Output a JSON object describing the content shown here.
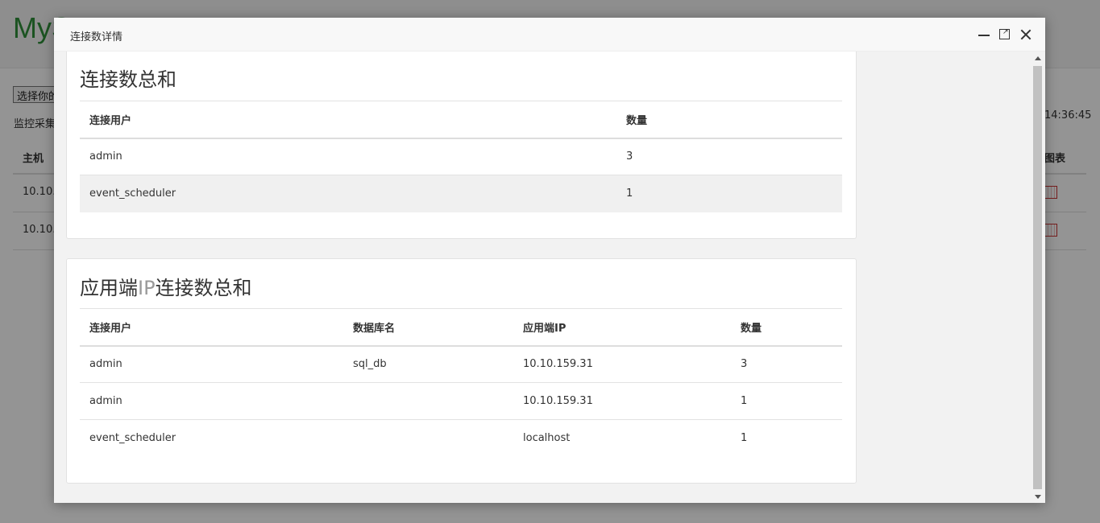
{
  "background": {
    "title": "MyS",
    "select_label": "选择你的",
    "collect_label": "监控采集",
    "time_label": "14:36:45",
    "table_headers": [
      "主机",
      "图表"
    ],
    "table_rows": [
      {
        "host": "10.10.1"
      },
      {
        "host": "10.10.1"
      }
    ]
  },
  "dialog": {
    "title": "连接数详情",
    "controls": {
      "minimize": "minimize-icon",
      "maximize": "maximize-icon",
      "close": "close-icon"
    }
  },
  "panel1": {
    "title": "连接数总和",
    "headers": [
      "连接用户",
      "数量"
    ],
    "rows": [
      [
        "admin",
        "3"
      ],
      [
        "event_scheduler",
        "1"
      ]
    ]
  },
  "panel2": {
    "title_prefix": "应用端",
    "title_ip": "IP",
    "title_suffix": "连接数总和",
    "headers": [
      "连接用户",
      "数据库名",
      "应用端IP",
      "数量"
    ],
    "rows": [
      [
        "admin",
        "sql_db",
        "10.10.159.31",
        "3"
      ],
      [
        "admin",
        "",
        "10.10.159.31",
        "1"
      ],
      [
        "event_scheduler",
        "",
        "localhost",
        "1"
      ]
    ]
  }
}
